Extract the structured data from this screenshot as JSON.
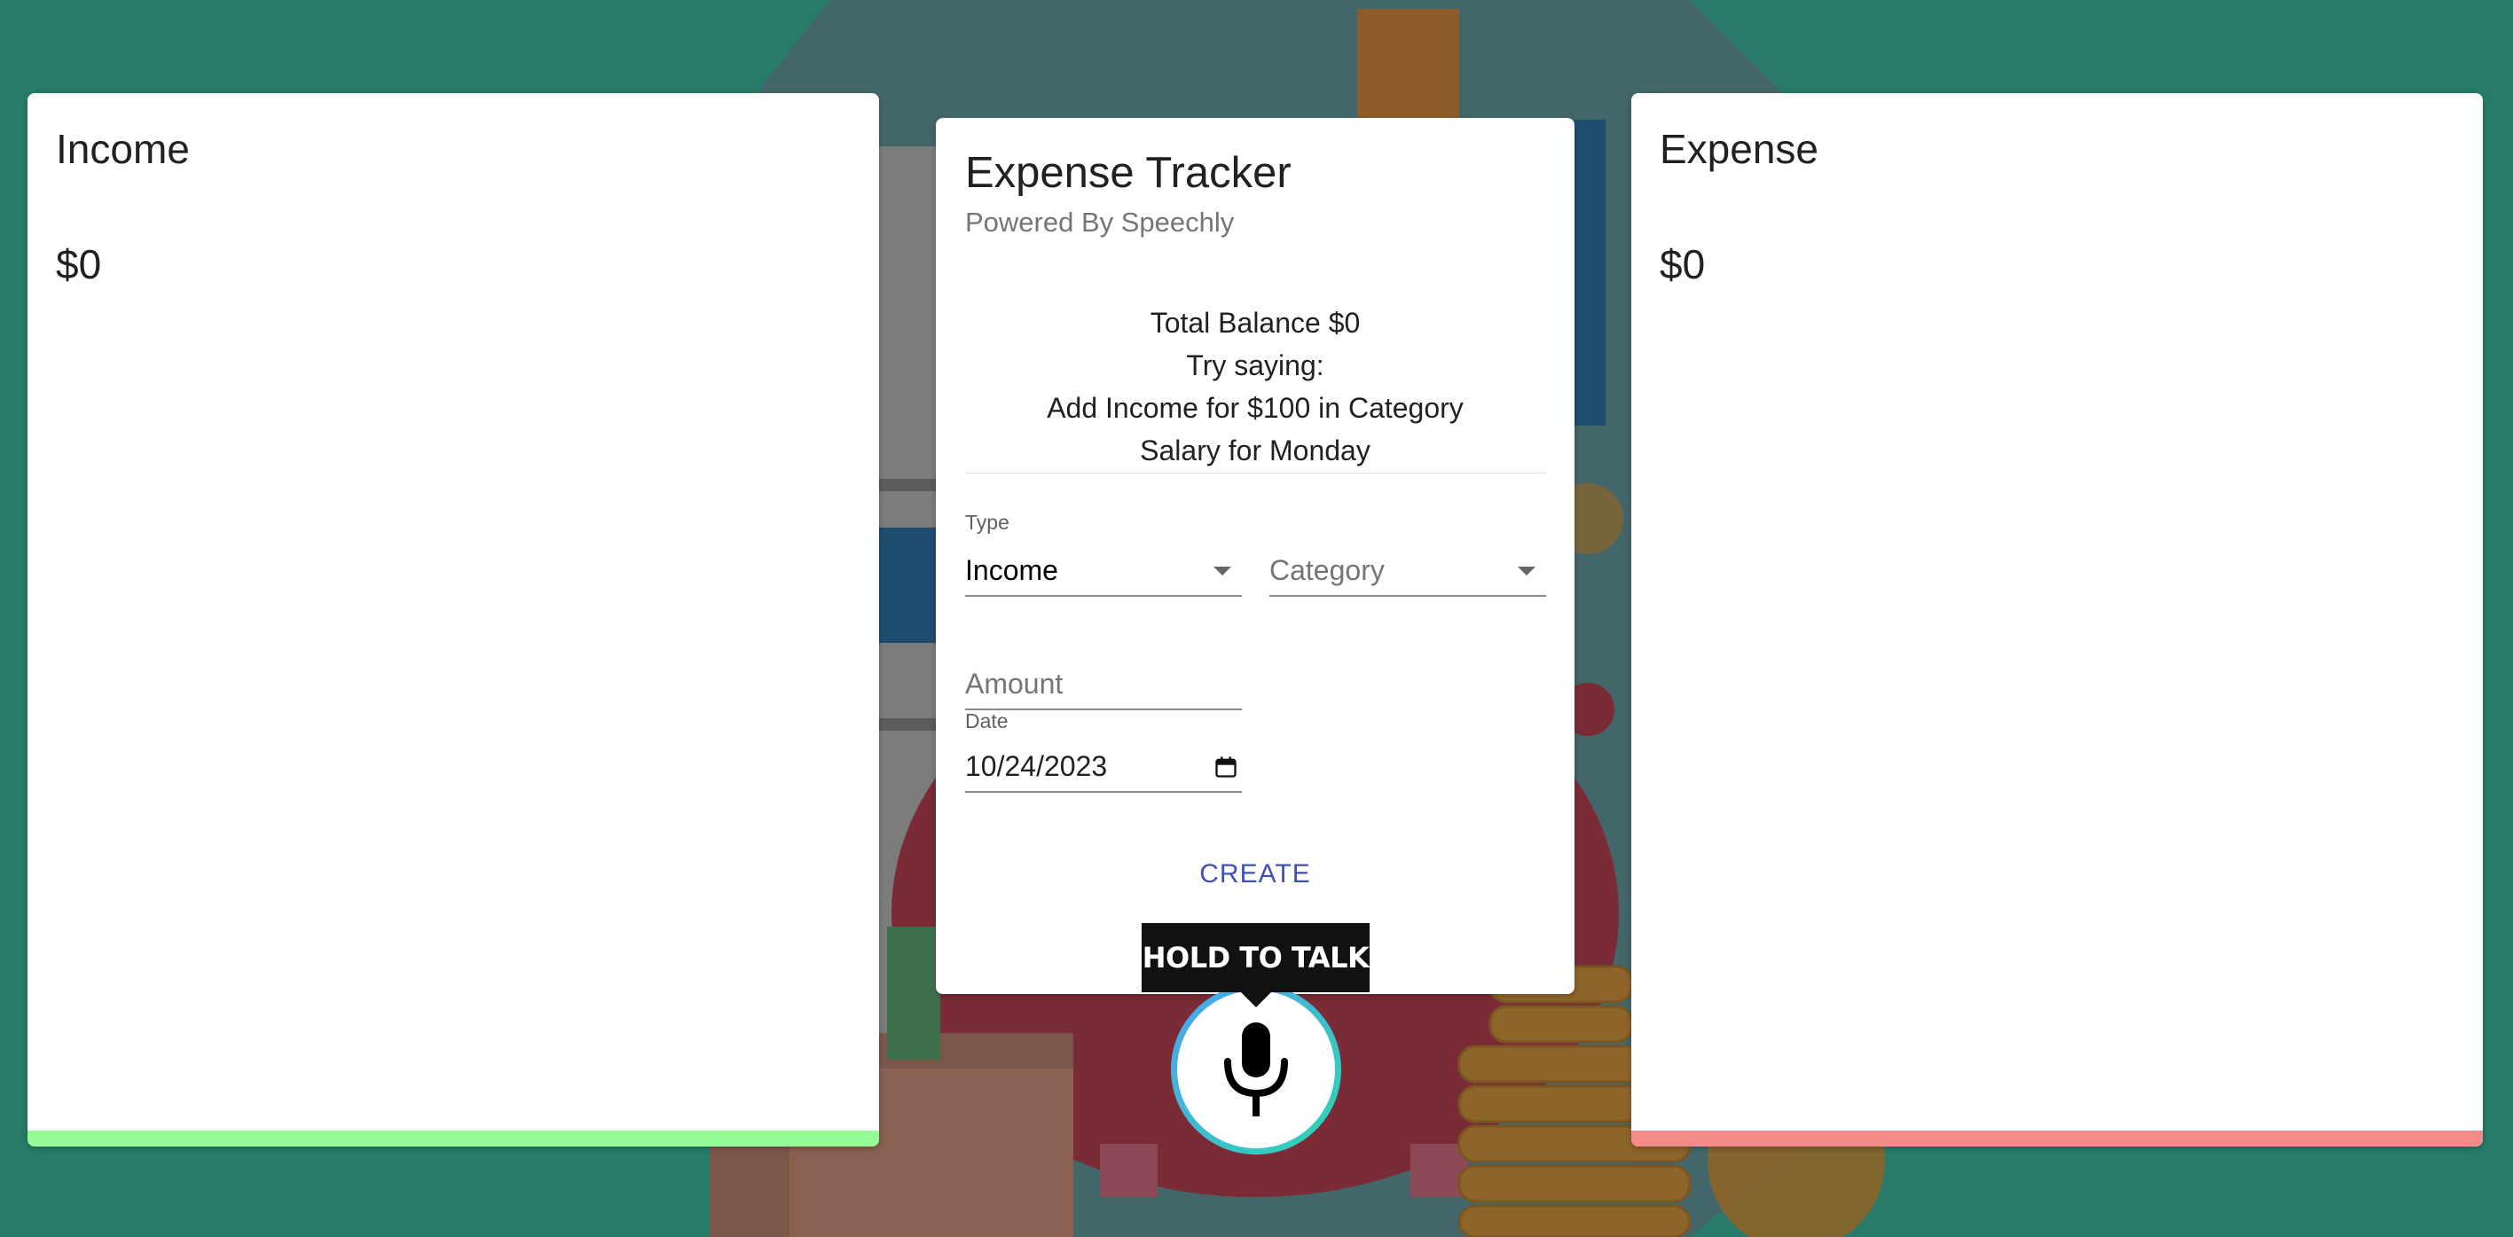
{
  "income": {
    "title": "Income",
    "amount": "$0",
    "accent_color": "#95f995"
  },
  "expense": {
    "title": "Expense",
    "amount": "$0",
    "accent_color": "#f58a8a"
  },
  "tracker": {
    "title": "Expense Tracker",
    "subtitle": "Powered By Speechly",
    "balance": "Total Balance $0",
    "hint_lines": [
      "Try saying:",
      "Add Income for $100 in Category",
      "Salary for Monday"
    ],
    "type_label": "Type",
    "type_value": "Income",
    "category_placeholder": "Category",
    "amount_placeholder": "Amount",
    "date_label": "Date",
    "date_value": "10/24/2023",
    "create_label": "CREATE",
    "create_color": "#3f51b5"
  },
  "voice": {
    "tooltip": "HOLD TO TALK",
    "icon": "microphone-icon"
  },
  "icons": {
    "dropdown": "chevron-down-icon",
    "calendar": "calendar-icon"
  }
}
